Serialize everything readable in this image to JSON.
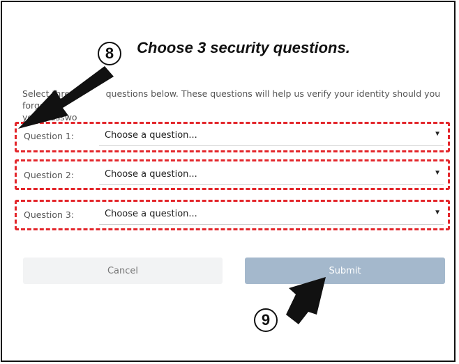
{
  "heading": "Choose 3 security questions.",
  "callouts": {
    "step_a": "8",
    "step_b": "9"
  },
  "intro": {
    "line1_start": "Select three",
    "line1_end": "questions below. These questions will help us verify your identity should you forget",
    "line2": "your passwo"
  },
  "questions": [
    {
      "label": "Question 1:",
      "value": "Choose a question..."
    },
    {
      "label": "Question 2:",
      "value": "Choose a question..."
    },
    {
      "label": "Question 3:",
      "value": "Choose a question..."
    }
  ],
  "buttons": {
    "cancel": "Cancel",
    "submit": "Submit"
  },
  "colors": {
    "highlight": "#e3262b",
    "submit_bg": "#a4b8cc",
    "cancel_bg": "#f2f3f4"
  },
  "icons": {
    "dropdown": "caret-down-icon",
    "pointer": "arrow-icon"
  }
}
